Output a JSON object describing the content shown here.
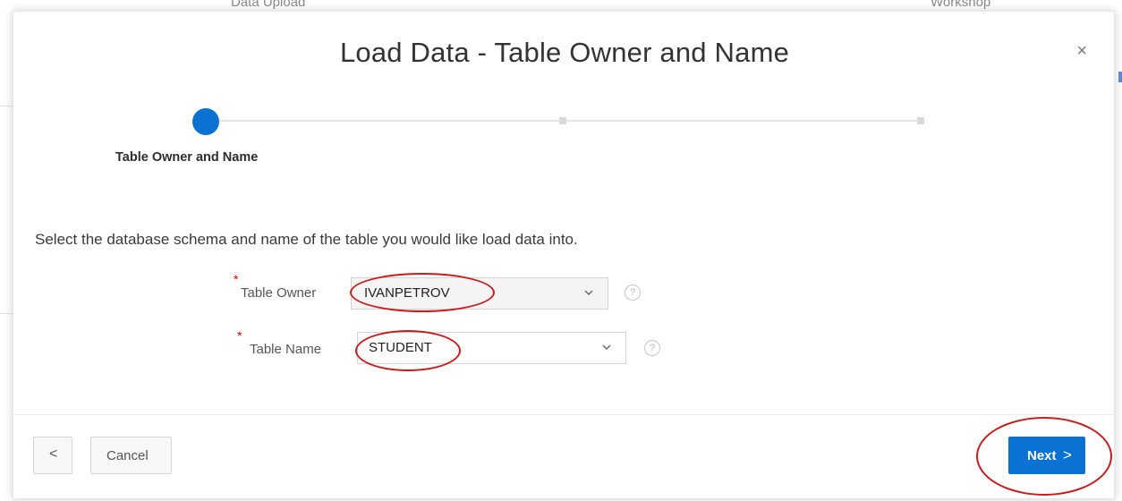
{
  "background": {
    "left_text": "Data Upload",
    "right_text": "Workshop"
  },
  "dialog": {
    "title": "Load Data - Table Owner and Name",
    "close_glyph": "×"
  },
  "wizard": {
    "steps": [
      {
        "label": "Table Owner and Name",
        "state": "current"
      },
      {
        "label": "",
        "state": "pending"
      },
      {
        "label": "",
        "state": "pending"
      }
    ],
    "active_color": "#0a72d2"
  },
  "form": {
    "instructions": "Select the database schema and name of the table you would like load data into.",
    "required_marker": "*",
    "fields": [
      {
        "label": "Table Owner",
        "value": "IVANPETROV",
        "help": "?"
      },
      {
        "label": "Table Name",
        "value": "STUDENT",
        "help": "?"
      }
    ]
  },
  "footer": {
    "prev_glyph": "<",
    "cancel_label": "Cancel",
    "next_label": "Next",
    "next_glyph": ">"
  },
  "annotation": {
    "color": "#cc1a1a"
  }
}
